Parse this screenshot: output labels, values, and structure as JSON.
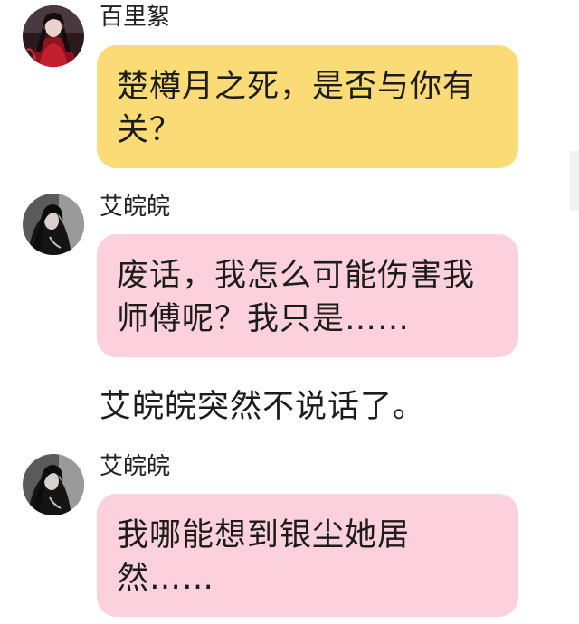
{
  "messages": [
    {
      "sender": "百里絮",
      "text": "楚樽月之死，是否与你有关？",
      "bubble_color": "#fbdb76",
      "avatar": "red-robed-woman-avatar"
    },
    {
      "sender": "艾皖皖",
      "text": "废话，我怎么可能伤害我师傅呢？我只是……",
      "bubble_color": "#fcd0dc",
      "avatar": "dark-haired-woman-avatar"
    },
    {
      "narration": "艾皖皖突然不说话了。"
    },
    {
      "sender": "艾皖皖",
      "text": "我哪能想到银尘她居然……",
      "bubble_color": "#fcd0dc",
      "avatar": "dark-haired-woman-avatar"
    }
  ]
}
